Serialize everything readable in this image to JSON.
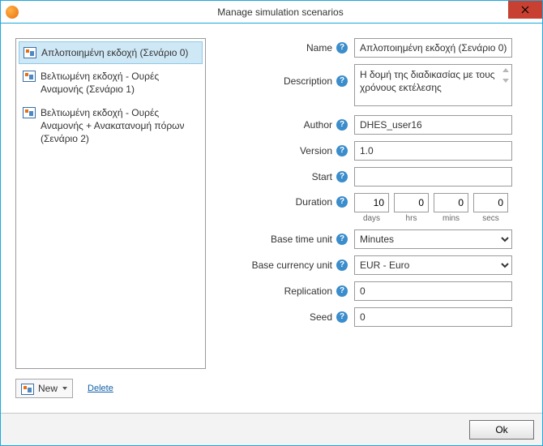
{
  "window": {
    "title": "Manage simulation scenarios",
    "close_tooltip": "Close"
  },
  "scenarios": {
    "items": [
      {
        "label": "Απλοποιημένη εκδοχή (Σενάριο 0)",
        "selected": true
      },
      {
        "label": "Βελτιωμένη εκδοχή - Ουρές Αναμονής (Σενάριο 1)",
        "selected": false
      },
      {
        "label": "Βελτιωμένη εκδοχή - Ουρές Αναμονής + Ανακατανομή πόρων (Σενάριο 2)",
        "selected": false
      }
    ],
    "new_label": "New",
    "delete_label": "Delete"
  },
  "form": {
    "name": {
      "label": "Name",
      "value": "Απλοποιημένη εκδοχή (Σενάριο 0)"
    },
    "description": {
      "label": "Description",
      "value": "Η δομή της διαδικασίας με τους χρόνους εκτέλεσης"
    },
    "author": {
      "label": "Author",
      "value": "DHES_user16"
    },
    "version": {
      "label": "Version",
      "value": "1.0"
    },
    "start": {
      "label": "Start",
      "value": ""
    },
    "duration": {
      "label": "Duration",
      "days": "10",
      "hrs": "0",
      "mins": "0",
      "secs": "0",
      "unit_days": "days",
      "unit_hrs": "hrs",
      "unit_mins": "mins",
      "unit_secs": "secs"
    },
    "base_time_unit": {
      "label": "Base time unit",
      "value": "Minutes"
    },
    "base_currency_unit": {
      "label": "Base currency unit",
      "value": "EUR - Euro"
    },
    "replication": {
      "label": "Replication",
      "value": "0"
    },
    "seed": {
      "label": "Seed",
      "value": "0"
    }
  },
  "help_glyph": "?",
  "footer": {
    "ok_label": "Ok"
  }
}
